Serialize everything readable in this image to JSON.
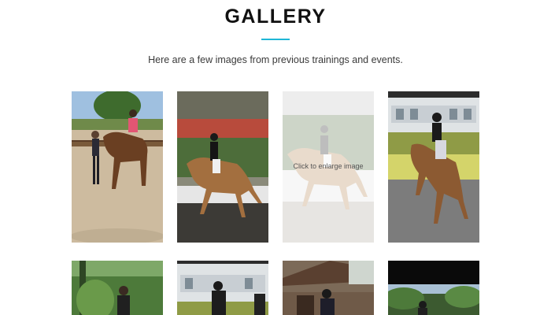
{
  "gallery": {
    "title": "GALLERY",
    "intro": "Here are a few images from previous trainings and events.",
    "accent_color": "#1fb6d6",
    "hover_label": "Click to enlarge image"
  },
  "images": [
    {
      "id": "photo-1",
      "alt": "Trainer with horse in arena"
    },
    {
      "id": "photo-2",
      "alt": "Dressage rider on bay horse"
    },
    {
      "id": "photo-3",
      "alt": "Rider at event (hovered)"
    },
    {
      "id": "photo-4",
      "alt": "Rider on brown horse in arena"
    },
    {
      "id": "photo-5",
      "alt": "Person among trees"
    },
    {
      "id": "photo-6",
      "alt": "Rider near white barn"
    },
    {
      "id": "photo-7",
      "alt": "Riders under shelter"
    },
    {
      "id": "photo-8",
      "alt": "Rider near trees"
    }
  ]
}
